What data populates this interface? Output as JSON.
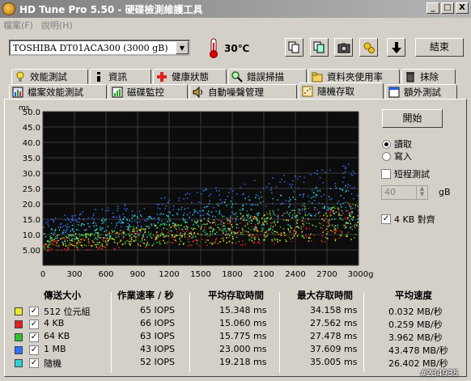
{
  "window": {
    "title": "HD Tune Pro 5.50 - 硬碟檢測維護工具",
    "minimize": "_",
    "maximize": "□",
    "close": "X"
  },
  "menu": [
    "檔案(F)",
    "說明(H)"
  ],
  "toolbar": {
    "drive": "TOSHIBA DT01ACA300 (3000 gB)",
    "temperature": "30℃",
    "exit_label": "結束"
  },
  "tabs_row1": [
    {
      "label": "效能測試",
      "icon": "bulb-icon"
    },
    {
      "label": "資訊",
      "icon": "info-icon"
    },
    {
      "label": "健康狀態",
      "icon": "health-cross-icon"
    },
    {
      "label": "錯誤掃描",
      "icon": "magnifier-icon"
    },
    {
      "label": "資料夾使用率",
      "icon": "folder-icon"
    },
    {
      "label": "抹除",
      "icon": "trash-icon"
    }
  ],
  "tabs_row2": [
    {
      "label": "檔案效能測試",
      "icon": "file-benchmark-icon"
    },
    {
      "label": "磁碟監控",
      "icon": "disk-monitor-icon"
    },
    {
      "label": "自動噪聲管理",
      "icon": "speaker-icon"
    },
    {
      "label": "隨機存取",
      "icon": "random-access-icon",
      "active": true
    },
    {
      "label": "額外測試",
      "icon": "extra-tests-icon"
    }
  ],
  "controls": {
    "start_label": "開始",
    "read_label": "讀取",
    "write_label": "寫入",
    "mode": "read",
    "short_stroke_label": "短程測試",
    "short_stroke_checked": false,
    "short_stroke_value": "40",
    "short_stroke_unit": "gB",
    "align_label": "4 KB 對齊",
    "align_checked": true
  },
  "chart_data": {
    "type": "scatter",
    "ylabel": "ms",
    "xunit": "gB",
    "ylim": [
      0,
      50
    ],
    "xlim": [
      0,
      3000
    ],
    "yticks": [
      "50.0",
      "45.0",
      "40.0",
      "35.0",
      "30.0",
      "25.0",
      "20.0",
      "15.0",
      "10.0",
      "5.00"
    ],
    "xticks": [
      "0",
      "300",
      "600",
      "900",
      "1200",
      "1500",
      "1800",
      "2100",
      "2400",
      "2700",
      "3000gB"
    ],
    "grid": true,
    "series": [
      {
        "name": "512 位元組",
        "color": "#e8e830",
        "access_ms": [
          7,
          12,
          22
        ]
      },
      {
        "name": "4 KB",
        "color": "#e02020",
        "access_ms": [
          6,
          12,
          22
        ]
      },
      {
        "name": "64 KB",
        "color": "#30c030",
        "access_ms": [
          7,
          13,
          23
        ]
      },
      {
        "name": "1 MB",
        "color": "#3070ff",
        "access_ms": [
          12,
          22,
          33
        ]
      },
      {
        "name": "隨機",
        "color": "#30d0d0",
        "access_ms": [
          9,
          17,
          28
        ]
      }
    ]
  },
  "table": {
    "headers": [
      "傳送大小",
      "作業速率 / 秒",
      "平均存取時間",
      "最大存取時間",
      "平均速度"
    ],
    "rows": [
      {
        "size": "512 位元組",
        "color": "#e8e830",
        "iops": "65 IOPS",
        "avg": "15.348 ms",
        "max": "34.158 ms",
        "speed": "0.032 MB/秒"
      },
      {
        "size": "4 KB",
        "color": "#e02020",
        "iops": "66 IOPS",
        "avg": "15.060 ms",
        "max": "27.562 ms",
        "speed": "0.259 MB/秒"
      },
      {
        "size": "64 KB",
        "color": "#30c030",
        "iops": "63 IOPS",
        "avg": "15.775 ms",
        "max": "27.478 ms",
        "speed": "3.962 MB/秒"
      },
      {
        "size": "1 MB",
        "color": "#3070ff",
        "iops": "43 IOPS",
        "avg": "23.000 ms",
        "max": "37.609 ms",
        "speed": "43.478 MB/秒"
      },
      {
        "size": "隨機",
        "color": "#30d0d0",
        "iops": "52 IOPS",
        "avg": "19.218 ms",
        "max": "35.005 ms",
        "speed": "26.402 MB/秒"
      }
    ]
  },
  "watermark": "#234935"
}
